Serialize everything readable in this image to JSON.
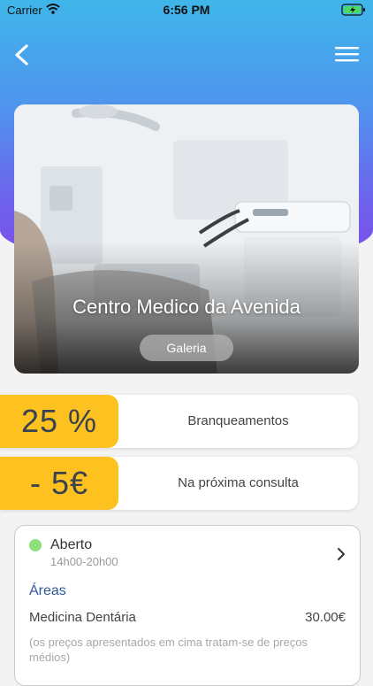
{
  "status_bar": {
    "carrier": "Carrier",
    "time": "6:56 PM"
  },
  "hero": {
    "title": "Centro Medico da Avenida",
    "gallery_label": "Galeria"
  },
  "promotions": [
    {
      "badge": "25 %",
      "description": "Branqueamentos"
    },
    {
      "badge": "- 5€",
      "description": "Na próxima consulta"
    }
  ],
  "info": {
    "status": "Aberto",
    "hours": "14h00-20h00",
    "areas_label": "Áreas",
    "service": {
      "name": "Medicina Dentária",
      "price": "30.00€"
    },
    "note": "(os preços apresentados em cima tratam-se de preços médios)"
  },
  "colors": {
    "badge": "#fdc21f",
    "status_open": "#8fe07a",
    "areas": "#2e5a9c"
  },
  "icons": [
    "back-arrow-icon",
    "menu-icon",
    "chevron-right-icon",
    "wifi-icon",
    "battery-icon"
  ]
}
